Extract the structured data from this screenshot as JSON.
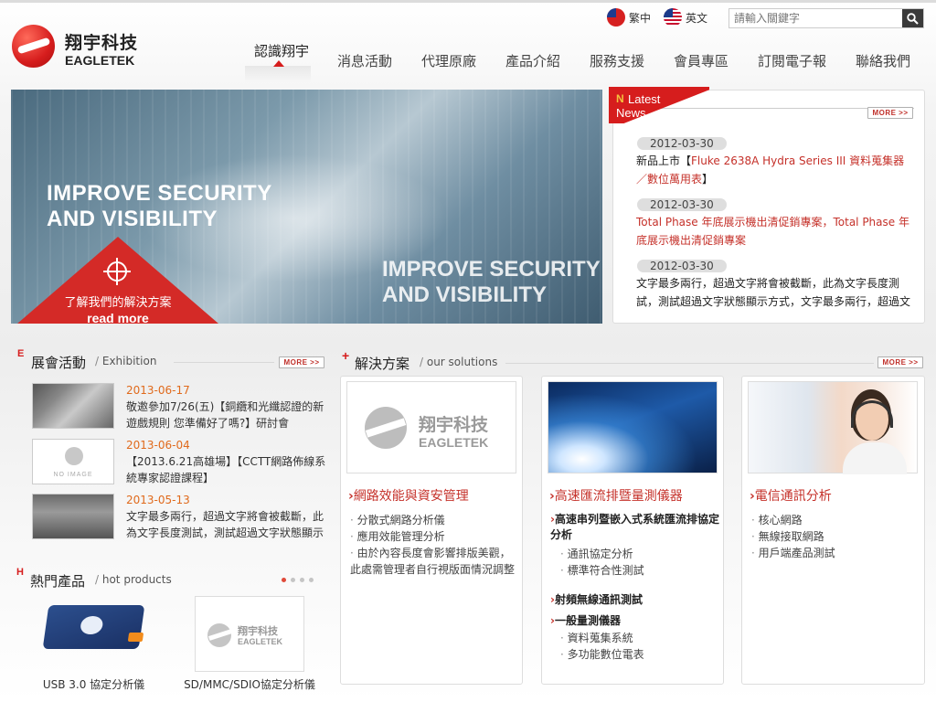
{
  "header": {
    "lang_tw": "繁中",
    "lang_en": "英文",
    "search_placeholder": "請輸入關鍵字",
    "logo_zh": "翔宇科技",
    "logo_en": "EAGLETEK"
  },
  "nav": [
    {
      "label": "認識翔宇",
      "active": true
    },
    {
      "label": "消息活動"
    },
    {
      "label": "代理原廠"
    },
    {
      "label": "產品介紹"
    },
    {
      "label": "服務支援"
    },
    {
      "label": "會員專區"
    },
    {
      "label": "訂閱電子報"
    },
    {
      "label": "聯絡我們"
    }
  ],
  "banner": {
    "headline_1": "IMPROVE SECURITY",
    "headline_2": "AND VISIBILITY",
    "cta_zh": "了解我們的解決方案",
    "cta_en": "read more"
  },
  "latest_news": {
    "tag_n": "N",
    "tag_line1": "Latest",
    "tag_line2": "News",
    "more": "MORE >>",
    "items": [
      {
        "date": "2012-03-30",
        "prefix": "新品上市【",
        "highlight": "Fluke 2638A Hydra Series III 資料蒐集器／數位萬用表",
        "suffix": "】"
      },
      {
        "date": "2012-03-30",
        "prefix": "",
        "highlight": "Total Phase 年底展示機出清促銷專案，Total Phase 年底展示機出清促銷專案",
        "suffix": ""
      },
      {
        "date": "2012-03-30",
        "prefix": "",
        "highlight": "文字最多兩行，超過文字將會被截斷，此為文字長度測試，測試超過文字狀態顯示方式，文字最多兩行，超過文",
        "suffix": ""
      }
    ]
  },
  "exhibition": {
    "letter": "E",
    "title": "展會活動",
    "subtitle": "Exhibition",
    "more": "MORE >>",
    "no_image": "NO IMAGE",
    "items": [
      {
        "date": "2013-06-17",
        "text": "敬邀參加7/26(五)【銅纜和光纖認證的新遊戲規則 您準備好了嗎?】研討會"
      },
      {
        "date": "2013-06-04",
        "text": "【2013.6.21高雄場】【CCTT網路佈線系統專家認證課程】"
      },
      {
        "date": "2013-05-13",
        "text": "文字最多兩行，超過文字將會被截斷，此為文字長度測試，測試超過文字狀態顯示"
      }
    ]
  },
  "hot_products": {
    "letter": "H",
    "title": "熱門產品",
    "subtitle": "hot products",
    "items": [
      {
        "label": "USB 3.0 協定分析儀"
      },
      {
        "label": "SD/MMC/SDIO協定分析儀"
      }
    ]
  },
  "solutions": {
    "letter": "+",
    "title": "解決方案",
    "subtitle": "our solutions",
    "more": "MORE >>",
    "cards": [
      {
        "title": "網路效能與資安管理",
        "items": [
          "分散式網路分析儀",
          "應用效能管理分析",
          "由於內容長度會影響排版美觀，此處需管理者自行視版面情況調整"
        ]
      },
      {
        "title": "高速匯流排暨量測儀器",
        "groups": [
          {
            "heading": "高速串列暨嵌入式系統匯流排協定分析",
            "items": [
              "通訊協定分析",
              "標準符合性測試"
            ]
          },
          {
            "heading": "射頻無線通訊測試",
            "items": []
          },
          {
            "heading": "一般量測儀器",
            "items": [
              "資料蒐集系統",
              "多功能數位電表"
            ]
          }
        ]
      },
      {
        "title": "電信通訊分析",
        "items": [
          "核心網路",
          "無線接取網路",
          "用戶端產品測試"
        ]
      }
    ]
  },
  "colors": {
    "brand_red": "#d61d1d",
    "date_orange": "#e06a1c",
    "link_red": "#c5312a"
  }
}
